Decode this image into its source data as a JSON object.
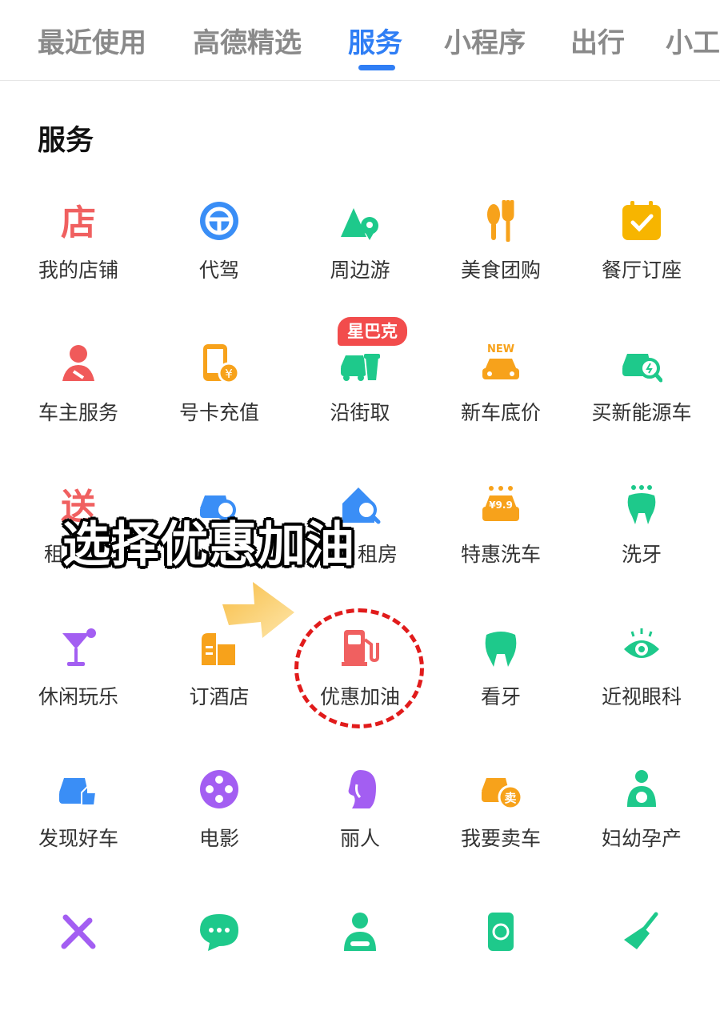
{
  "tabs": [
    {
      "label": "最近使用",
      "active": false
    },
    {
      "label": "高德精选",
      "active": false
    },
    {
      "label": "服务",
      "active": true
    },
    {
      "label": "小程序",
      "active": false
    },
    {
      "label": "出行",
      "active": false
    },
    {
      "label": "小工",
      "active": false
    }
  ],
  "section_title": "服务",
  "grid": [
    {
      "label": "我的店铺",
      "icon": "store-icon"
    },
    {
      "label": "代驾",
      "icon": "steering-wheel-icon"
    },
    {
      "label": "周边游",
      "icon": "mountain-pin-icon"
    },
    {
      "label": "美食团购",
      "icon": "fork-spoon-icon"
    },
    {
      "label": "餐厅订座",
      "icon": "calendar-check-icon"
    },
    {
      "label": "车主服务",
      "icon": "driver-icon"
    },
    {
      "label": "号卡充值",
      "icon": "phone-card-icon"
    },
    {
      "label": "沿街取",
      "icon": "car-cup-icon",
      "badge": "星巴克"
    },
    {
      "label": "新车底价",
      "icon": "new-car-icon",
      "tag": "NEW"
    },
    {
      "label": "买新能源车",
      "icon": "ev-car-search-icon"
    },
    {
      "label": "租",
      "icon": "delivery-icon"
    },
    {
      "label": "",
      "icon": "car-search-icon"
    },
    {
      "label": "租房",
      "icon": "house-search-icon"
    },
    {
      "label": "特惠洗车",
      "icon": "car-wash-icon",
      "tag": "¥9.9"
    },
    {
      "label": "洗牙",
      "icon": "tooth-drops-icon"
    },
    {
      "label": "休闲玩乐",
      "icon": "cocktail-icon"
    },
    {
      "label": "订酒店",
      "icon": "hotel-building-icon"
    },
    {
      "label": "优惠加油",
      "icon": "fuel-pump-icon"
    },
    {
      "label": "看牙",
      "icon": "tooth-icon"
    },
    {
      "label": "近视眼科",
      "icon": "eye-icon"
    },
    {
      "label": "发现好车",
      "icon": "car-thumbs-up-icon"
    },
    {
      "label": "电影",
      "icon": "film-reel-icon"
    },
    {
      "label": "丽人",
      "icon": "woman-profile-icon"
    },
    {
      "label": "我要卖车",
      "icon": "sell-car-icon",
      "tag": "卖"
    },
    {
      "label": "妇幼孕产",
      "icon": "mother-baby-icon"
    },
    {
      "label": "",
      "icon": "tools-icon"
    },
    {
      "label": "",
      "icon": "chat-bubble-icon"
    },
    {
      "label": "",
      "icon": "driver-seat-icon"
    },
    {
      "label": "",
      "icon": "phone-recycle-icon"
    },
    {
      "label": "",
      "icon": "broom-icon"
    }
  ],
  "overlay_caption": "选择优惠加油",
  "colors": {
    "accent": "#2f7ef5",
    "annotation": "#e11b1b",
    "badge": "#f24c4c"
  }
}
